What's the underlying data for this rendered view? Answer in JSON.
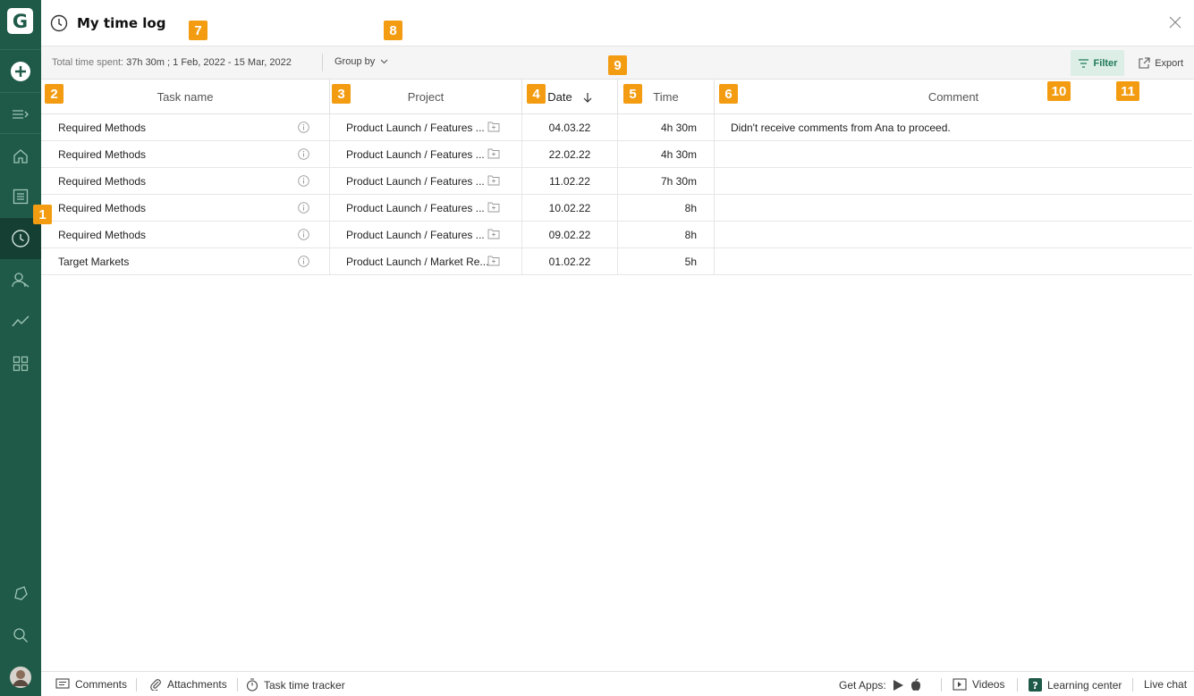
{
  "app": {
    "logo_letter": "G"
  },
  "header": {
    "title": "My time log"
  },
  "toolbar": {
    "summary_label": "Total time spent:",
    "total_time": "37h 30m ;",
    "date_range": "1 Feb, 2022 - 15 Mar, 2022",
    "group_by_label": "Group by",
    "filter_label": "Filter",
    "export_label": "Export"
  },
  "table": {
    "columns": [
      "Task name",
      "Project",
      "Date",
      "Time",
      "Comment"
    ],
    "rows": [
      {
        "task": "Required Methods",
        "project": "Product Launch / Features ...",
        "date": "04.03.22",
        "time": "4h 30m",
        "comment": "Didn't receive comments from Ana to proceed."
      },
      {
        "task": "Required Methods",
        "project": "Product Launch / Features ...",
        "date": "22.02.22",
        "time": "4h 30m",
        "comment": ""
      },
      {
        "task": "Required Methods",
        "project": "Product Launch / Features ...",
        "date": "11.02.22",
        "time": "7h 30m",
        "comment": ""
      },
      {
        "task": "Required Methods",
        "project": "Product Launch / Features ...",
        "date": "10.02.22",
        "time": "8h",
        "comment": ""
      },
      {
        "task": "Required Methods",
        "project": "Product Launch / Features ...",
        "date": "09.02.22",
        "time": "8h",
        "comment": ""
      },
      {
        "task": "Target Markets",
        "project": "Product Launch / Market Re...",
        "date": "01.02.22",
        "time": "5h",
        "comment": ""
      }
    ]
  },
  "footer": {
    "comments": "Comments",
    "attachments": "Attachments",
    "task_time_tracker": "Task time tracker",
    "get_apps": "Get Apps:",
    "videos": "Videos",
    "learning_center": "Learning center",
    "live_chat": "Live chat"
  },
  "markers": [
    "1",
    "2",
    "3",
    "4",
    "5",
    "6",
    "7",
    "8",
    "9",
    "10",
    "11"
  ],
  "colors": {
    "sidebar": "#1f5a48",
    "sidebar_active": "#163f33",
    "accent": "#1f7a5a",
    "marker": "#f39c12"
  }
}
